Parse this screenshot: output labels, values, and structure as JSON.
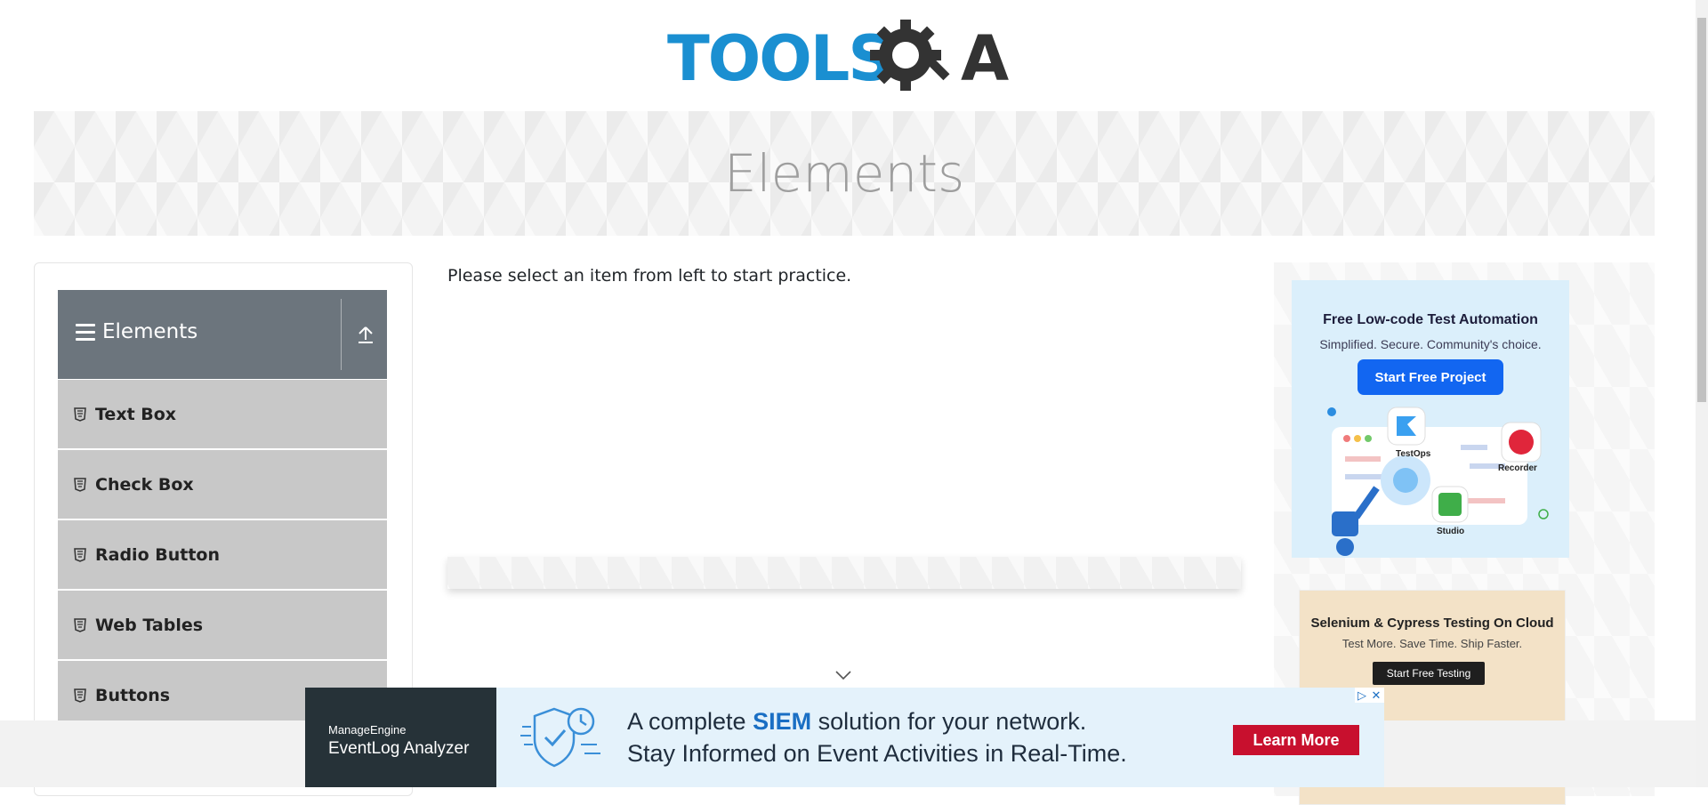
{
  "header": {
    "logo_text": "TOOLSQA"
  },
  "banner": {
    "title": "Elements"
  },
  "sidebar": {
    "group_title": "Elements",
    "items": [
      {
        "label": "Text Box"
      },
      {
        "label": "Check Box"
      },
      {
        "label": "Radio Button"
      },
      {
        "label": "Web Tables"
      },
      {
        "label": "Buttons"
      }
    ]
  },
  "main": {
    "instructions": "Please select an item from left to start practice."
  },
  "right_ads": {
    "ad1": {
      "title": "Free Low-code Test Automation",
      "subtitle": "Simplified. Secure. Community's choice.",
      "button": "Start Free Project",
      "labels": [
        "TestOps",
        "Recorder",
        "Studio"
      ]
    },
    "ad2": {
      "title": "Selenium & Cypress Testing On Cloud",
      "subtitle": "Test More. Save Time. Ship Faster.",
      "button": "Start Free Testing"
    }
  },
  "bottom_ad": {
    "brand_top": "ManageEngine",
    "brand_bottom": "EventLog Analyzer",
    "line1_pre": "A complete ",
    "line1_highlight": "SIEM",
    "line1_post": " solution for your network.",
    "line2": "Stay Informed on Event Activities in Real-Time.",
    "button": "Learn More"
  },
  "colors": {
    "brand_blue": "#1a8fd1",
    "nav_header": "#6c757d",
    "nav_item": "#c8c8c8",
    "cta_red": "#c8102e",
    "cta_blue": "#1266f1"
  }
}
